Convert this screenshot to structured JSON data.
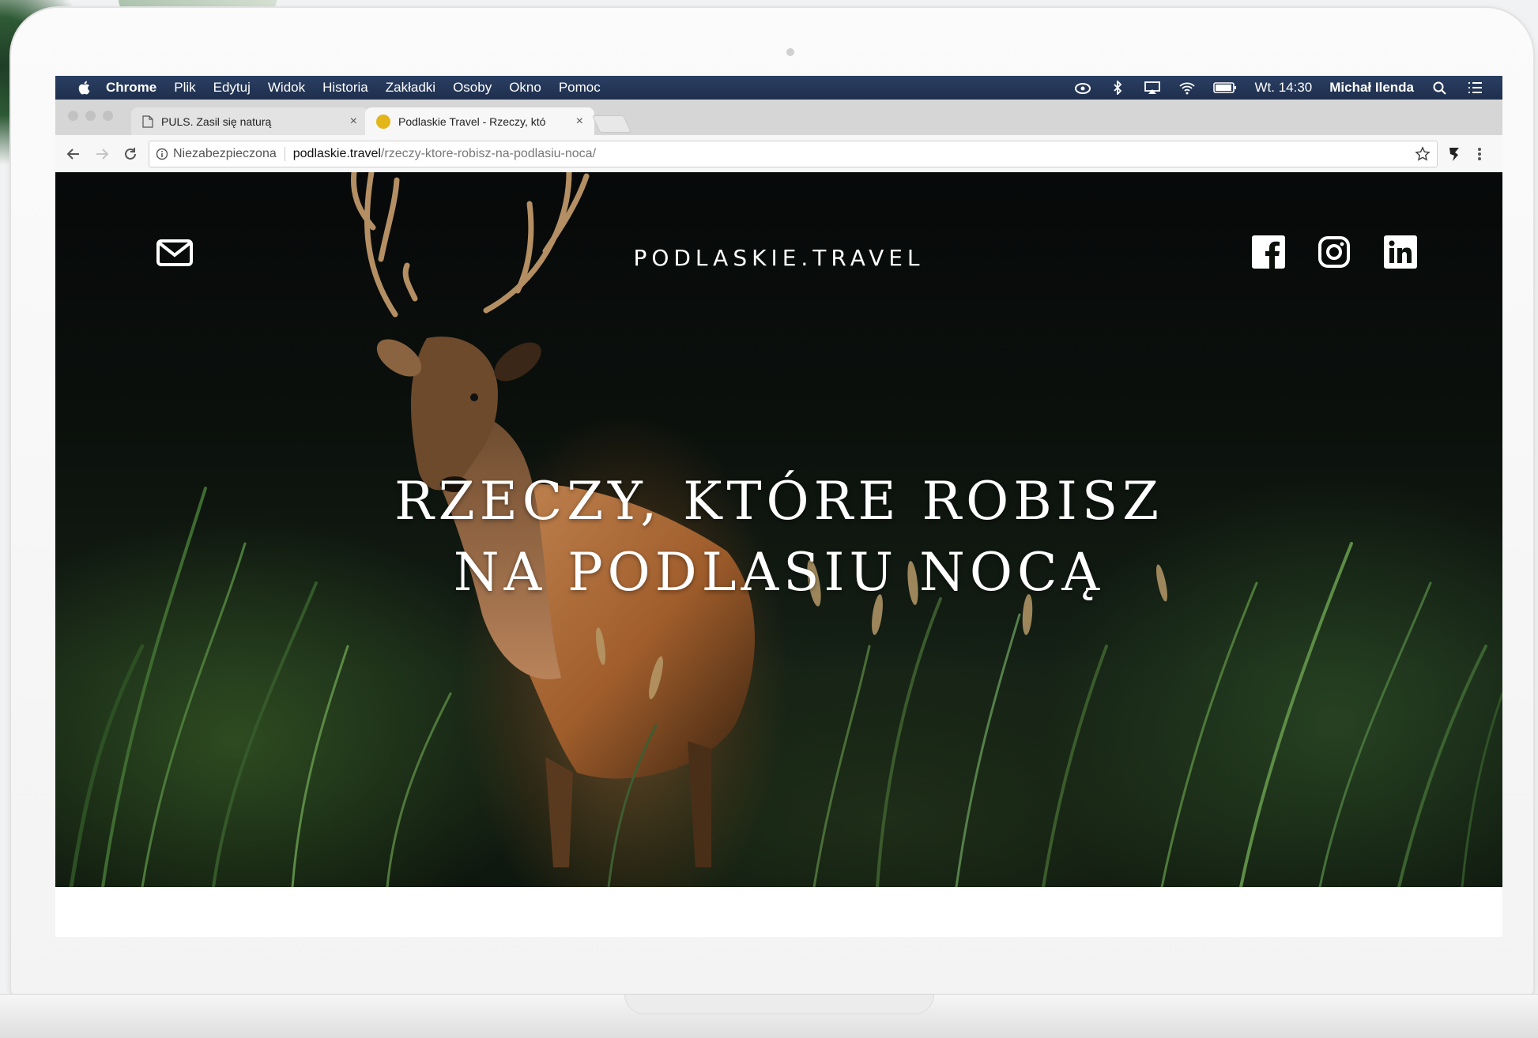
{
  "menubar": {
    "items": [
      "Chrome",
      "Plik",
      "Edytuj",
      "Widok",
      "Historia",
      "Zakładki",
      "Osoby",
      "Okno",
      "Pomoc"
    ],
    "clock": "Wt. 14:30",
    "user": "Michał Ilenda"
  },
  "tabs": [
    {
      "title": "PULS. Zasil się naturą",
      "close": "×"
    },
    {
      "title": "Podlaskie Travel - Rzeczy, któ",
      "close": "×"
    }
  ],
  "address": {
    "security": "Niezabezpieczona",
    "host": "podlaskie.travel",
    "path": "/rzeczy-ktore-robisz-na-podlasiu-noca/"
  },
  "page": {
    "brand": "PODLASKIE.TRAVEL",
    "headline_line1": "RZECZY, KTÓRE ROBISZ",
    "headline_line2": "NA PODLASIU NOCĄ"
  },
  "icons": {
    "mail": "mail-icon",
    "facebook": "facebook-icon",
    "instagram": "instagram-icon",
    "linkedin": "linkedin-icon"
  },
  "colors": {
    "menubar": "#1f2f4d",
    "favicon": "#e3b518",
    "hero_text": "#ffffff"
  }
}
